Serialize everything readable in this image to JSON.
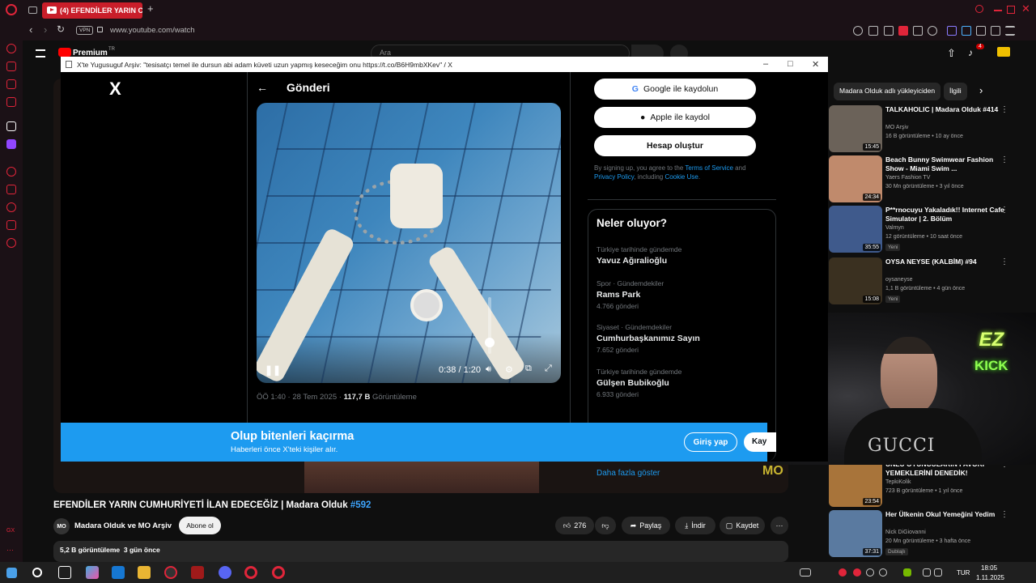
{
  "browser": {
    "tab_title": "(4) EFENDİLER YARIN CUM",
    "url": "www.youtube.com/watch",
    "vpn": "VPN"
  },
  "youtube": {
    "logo": "Premium",
    "region": "TR",
    "search_placeholder": "Ara",
    "notif_count": "4",
    "video_title": "EFENDİLER YARIN CUMHURİYETİ İLAN EDECEĞİZ | Madara Olduk",
    "hashtag": "#592",
    "channel": "Madara Olduk ve MO Arşiv",
    "subscribe": "Abone ol",
    "likes": "276",
    "share": "Paylaş",
    "download": "İndir",
    "save": "Kaydet",
    "views": "5,2 B görüntüleme",
    "ago": "3 gün önce",
    "chips": {
      "a": "Madara Olduk adlı yükleyiciden",
      "b": "İlgili"
    },
    "recs": [
      {
        "title": "TALKAHOLIC | Madara Olduk #414",
        "channel": "MO Arşiv",
        "meta": "16 B görüntüleme • 10 ay önce",
        "duration": "15:45",
        "thumb": "#6b6259"
      },
      {
        "title": "Beach Bunny Swimwear Fashion Show - Miami Swim ...",
        "channel": "Yaers Fashion TV",
        "meta": "30 Mn görüntüleme • 3 yıl önce",
        "duration": "24:34",
        "thumb": "#c08a6c"
      },
      {
        "title": "P**rnocuyu Yakaladık!! Internet Cafe Simulator | 2. Bölüm",
        "channel": "Valmyn",
        "meta": "12 görüntüleme • 10 saat önce",
        "duration": "35:55",
        "thumb": "#3f5a8c",
        "badge": "Yeni"
      },
      {
        "title": "OYSA NEYSE (KALBİM) #94",
        "channel": "oysaneyse",
        "meta": "1,1 B görüntüleme • 4 gün önce",
        "duration": "15:08",
        "thumb": "#3a3020",
        "badge": "Yeni"
      },
      {
        "title": "ÜNLÜ OYUNCULARIN FAVORİ YEMEKLERİNİ DENEDİK!",
        "channel": "TepkiKolik",
        "meta": "723 B görüntüleme • 1 yıl önce",
        "duration": "23:54",
        "thumb": "#a8743a"
      },
      {
        "title": "Her Ülkenin Okul Yemeğini Yedim",
        "channel": "Nick DiGiovanni",
        "meta": "20 Mn görüntüleme • 3 hafta önce",
        "duration": "37:31",
        "thumb": "#5a7aa0",
        "badge": "Dublajlı"
      }
    ]
  },
  "popup": {
    "window_title": "X'te Yugusuguf Arşiv: \"tesisatçı temel ile dursun abi adam küveti uzun yapmış keseceğim onu https://t.co/B6H9mbXKev\" / X",
    "x_logo": "X",
    "post_header": "Gönderi",
    "video_time": "0:38 / 1:20",
    "post_meta": {
      "time": "ÖÖ 1:40 · 28 Tem 2025 · ",
      "views": "117,7 B",
      "views_label": " Görüntüleme"
    },
    "google_btn": "Google ile kaydolun",
    "apple_btn": "Apple ile kaydol",
    "create_btn": "Hesap oluştur",
    "legal": {
      "a": "By signing up, you agree to the ",
      "tos": "Terms of Service",
      "b": " and ",
      "pp": "Privacy Policy",
      "c": ", including ",
      "cu": "Cookie Use",
      "d": "."
    },
    "trends_title": "Neler oluyor?",
    "trends": [
      {
        "cat": "Türkiye tarihinde gündemde",
        "name": "Yavuz Ağıralioğlu",
        "count": ""
      },
      {
        "cat": "Spor · Gündemdekiler",
        "name": "Rams Park",
        "count": "4.766 gönderi"
      },
      {
        "cat": "Siyaset · Gündemdekiler",
        "name": "Cumhurbaşkanımız Sayın",
        "count": "7.652 gönderi"
      },
      {
        "cat": "Türkiye tarihinde gündemde",
        "name": "Gülşen Bubikoğlu",
        "count": "6.933 gönderi"
      }
    ],
    "show_more": "Daha fazla göster",
    "banner": {
      "title": "Olup bitenleri kaçırma",
      "sub": "Haberleri önce X'teki kişiler alır.",
      "login": "Giriş yap",
      "signup": "Kay"
    }
  },
  "webcam": {
    "neon_top": "EZ",
    "neon_bottom": "KICK",
    "shirt": "GUCCI"
  },
  "taskbar": {
    "lang": "TUR",
    "time": "18:05",
    "date": "1.11.2025"
  }
}
